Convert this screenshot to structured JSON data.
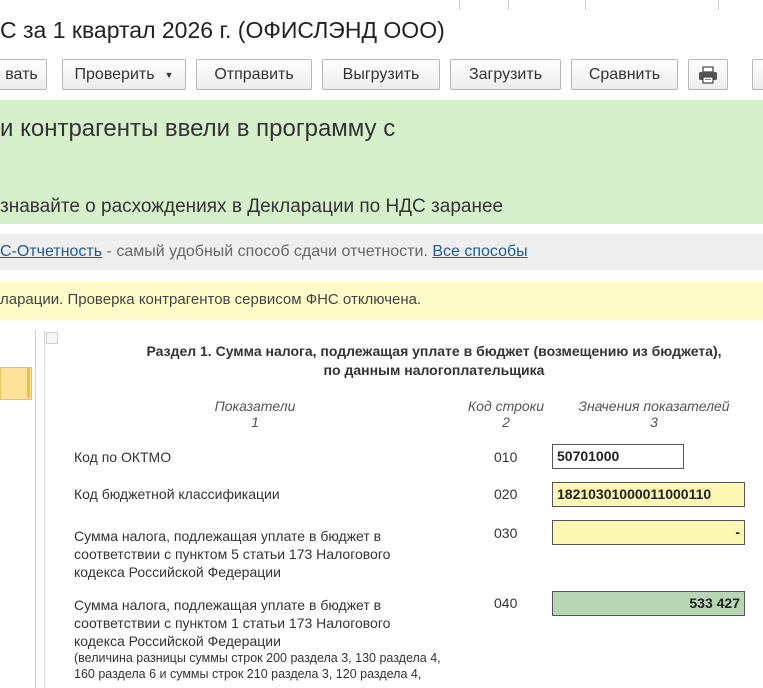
{
  "window": {
    "title": "С за 1 квартал 2026 г. (ОФИСЛЭНД ООО)"
  },
  "toolbar": {
    "btn_write": "вать",
    "btn_check": "Проверить",
    "btn_send": "Отправить",
    "btn_export": "Выгрузить",
    "btn_import": "Загрузить",
    "btn_compare": "Сравнить"
  },
  "banner": {
    "headline": "и контрагенты ввели в программу с",
    "subline": "знавайте о расхождениях в Декларации по НДС заранее"
  },
  "promo": {
    "link": "С-Отчетность",
    "text": " - самый удобный способ сдачи отчетности. ",
    "all_ways": "Все способы"
  },
  "notice": {
    "text": "ларации. Проверка контрагентов сервисом ФНС отключена."
  },
  "section": {
    "title_line1": "Раздел 1. Сумма налога, подлежащая уплате в бюджет (возмещению из бюджета),",
    "title_line2": "по данным налогоплательщика",
    "col1_line1": "Показатели",
    "col1_line2": "1",
    "col2_line1": "Код строки",
    "col2_line2": "2",
    "col3_line1": "Значения показателей",
    "col3_line2": "3"
  },
  "rows": [
    {
      "label": "Код по ОКТМО",
      "code": "010",
      "value": "50701000"
    },
    {
      "label": "Код бюджетной классификации",
      "code": "020",
      "value": "18210301000011000110"
    },
    {
      "label_l1": "Сумма налога, подлежащая уплате в бюджет в",
      "label_l2": "соответствии с пунктом 5 статьи 173 Налогового",
      "label_l3": "кодекса Российской Федерации",
      "code": "030",
      "value": "-"
    },
    {
      "label_l1": "Сумма налога, подлежащая уплате в бюджет в",
      "label_l2": "соответствии с пунктом 1 статьи 173 Налогового",
      "label_l3": "кодекса Российской Федерации",
      "note_l1": "(величина разницы суммы строк 200 раздела 3, 130 раздела 4,",
      "note_l2": "160 раздела 6 и суммы строк 210 раздела 3, 120 раздела 4,",
      "code": "040",
      "value": "533 427"
    }
  ],
  "colors": {
    "banner_bg": "#d6f0cc",
    "notice_bg": "#fdfcc8",
    "field_yellow": "#fcf8b4",
    "field_green": "#b8d6b5",
    "link": "#1a5a96"
  }
}
